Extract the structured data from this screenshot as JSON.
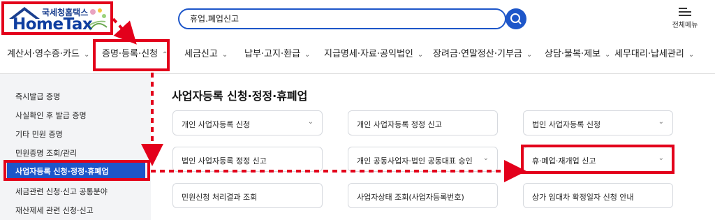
{
  "header": {
    "logo_sub": "국세청홈택스",
    "logo_main": "HomeTax",
    "search_value": "휴업.폐업신고",
    "menu_label": "전체메뉴"
  },
  "nav": [
    "계산서·영수증·카드",
    "증명·등록·신청",
    "세금신고",
    "납부·고지·환급",
    "지급명세·자료·공익법인",
    "장려금·연말정산·기부금",
    "상담·불복·제보",
    "세무대리·납세관리"
  ],
  "sidebar": [
    "즉시발급 증명",
    "사실확인 후 발급 증명",
    "기타 민원 증명",
    "민원증명 조회/관리",
    "사업자등록 신청·정정·휴폐업",
    "세금관련 신청·신고 공통분야",
    "재산제세 관련 신청·신고"
  ],
  "content": {
    "title": "사업자등록 신청·정정·휴폐업",
    "cards": [
      "개인 사업자등록 신청",
      "개인 사업자등록 정정 신고",
      "법인 사업자등록 신청",
      "법인 사업자등록 정정 신고",
      "개인 공동사업자·법인 공동대표 승인",
      "휴·폐업·재개업 신고",
      "민원신청 처리결과 조회",
      "사업자상태 조회(사업자등록번호)",
      "상가 임대차 확정일자 신청 안내"
    ]
  },
  "colors": {
    "accent": "#1d56c9",
    "annotation": "#e3001b"
  }
}
